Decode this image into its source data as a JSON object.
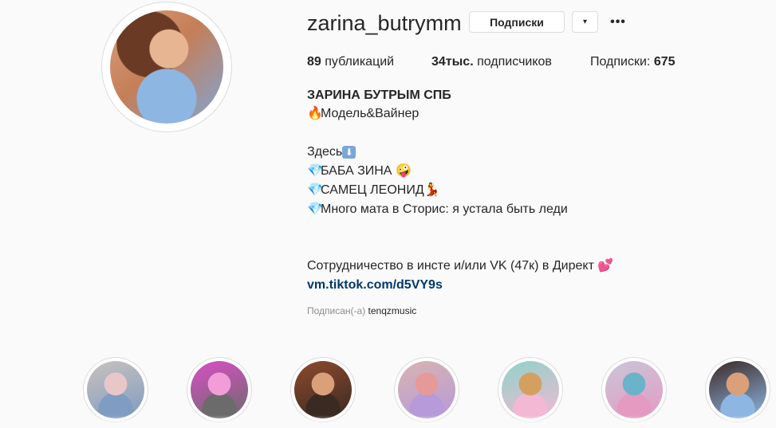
{
  "profile": {
    "username": "zarina_butrymm",
    "subscribe_label": "Подписки",
    "dropdown_glyph": "▾",
    "more_glyph": "•••"
  },
  "stats": {
    "posts_count": "89",
    "posts_label": "публикаций",
    "followers_count": "34тыс.",
    "followers_label": "подписчиков",
    "following_label": "Подписки:",
    "following_count": "675"
  },
  "bio": {
    "name": "ЗАРИНА БУТРЫМ СПБ",
    "line1": "Модель&Вайнер",
    "line2": "Здесь",
    "line3": "БАБА ЗИНА",
    "line4": "САМЕЦ ЛЕОНИД",
    "line5": "Много мата в Сторис: я устала быть леди",
    "line6": "Сотрудничество в инсте и/или VK (47к) в Директ",
    "link": "vm.tiktok.com/d5VY9s",
    "emoji_fire": "🔥",
    "emoji_down": "⬇",
    "emoji_gem": "💎",
    "emoji_crazy": "🤪",
    "emoji_dancer": "💃",
    "emoji_hearts": "💕"
  },
  "followed_by": {
    "label": "Подписан(-а)",
    "user": "tenqzmusic"
  },
  "highlights": [
    {
      "name": "highlight-1",
      "colors": [
        "#c9c2bd",
        "#e8c7c9",
        "#7f9cc2"
      ]
    },
    {
      "name": "highlight-2",
      "colors": [
        "#d94fc5",
        "#f39dd8",
        "#6b6b6b"
      ]
    },
    {
      "name": "highlight-3",
      "colors": [
        "#8e4a2e",
        "#d9a07a",
        "#3a2a22"
      ]
    },
    {
      "name": "highlight-4",
      "colors": [
        "#d8b4b0",
        "#e59a9a",
        "#b69ad9"
      ]
    },
    {
      "name": "highlight-5",
      "colors": [
        "#8fd3c8",
        "#d4a060",
        "#f3b8d4"
      ]
    },
    {
      "name": "highlight-6",
      "colors": [
        "#c9c6d8",
        "#6bb3c9",
        "#e59ac2"
      ]
    },
    {
      "name": "highlight-7",
      "colors": [
        "#3b2a26",
        "#d9a07a",
        "#8eb6e3"
      ]
    }
  ]
}
